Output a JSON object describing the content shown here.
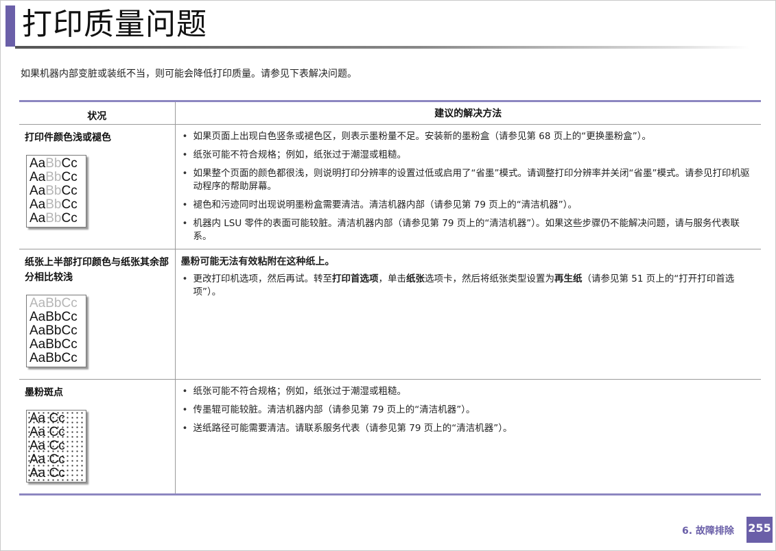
{
  "title": "打印质量问题",
  "intro": "如果机器内部变脏或装纸不当，则可能会降低打印质量。请参见下表解决问题。",
  "table": {
    "headers": [
      "状况",
      "建议的解决方法"
    ],
    "rows": [
      {
        "condition": "打印件颜色浅或褪色",
        "sample_text": "AaBbCc",
        "solutions": [
          "如果页面上出现白色竖条或褪色区，则表示墨粉量不足。安装新的墨粉盒（请参见第 68 页上的“更换墨粉盒”）。",
          "纸张可能不符合规格；例如，纸张过于潮湿或粗糙。",
          "如果整个页面的颜色都很浅，则说明打印分辨率的设置过低或启用了“省墨”模式。请调整打印分辨率并关闭“省墨”模式。请参见打印机驱动程序的帮助屏幕。",
          "褪色和污迹同时出现说明墨粉盒需要清洁。清洁机器内部（请参见第 79 页上的“清洁机器”）。",
          "机器内 LSU 零件的表面可能较脏。清洁机器内部（请参见第 79 页上的“清洁机器”）。如果这些步骤仍不能解决问题，请与服务代表联系。"
        ]
      },
      {
        "condition": "纸张上半部打印颜色与纸张其余部分相比较浅",
        "sample_text": "AaBbCc",
        "lead": "墨粉可能无法有效粘附在这种纸上。",
        "solution_parts": {
          "p1": "更改打印机选项，然后再试。转至",
          "b1": "打印首选项",
          "p2": "，单击",
          "b2": "纸张",
          "p3": "选项卡，然后将纸张类型设置为",
          "b3": "再生纸",
          "p4": "（请参见第 51 页上的“打开打印首选项”）。"
        }
      },
      {
        "condition": "墨粉斑点",
        "sample_text": "Aa Cc",
        "solutions": [
          "纸张可能不符合规格；例如，纸张过于潮湿或粗糙。",
          "传墨辊可能较脏。清洁机器内部（请参见第 79 页上的“清洁机器”）。",
          "送纸路径可能需要清洁。请联系服务代表（请参见第 79 页上的“清洁机器”）。"
        ]
      }
    ]
  },
  "footer": {
    "chapter": "6.  故障排除",
    "page": "255"
  },
  "colors": {
    "accent": "#6a5fa8",
    "table_rule": "#8c86c0"
  }
}
